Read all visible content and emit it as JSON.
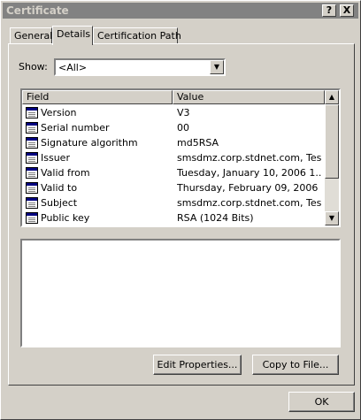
{
  "window": {
    "title": "Certificate"
  },
  "titlebar_buttons": {
    "help": "?",
    "close": "X"
  },
  "tabs": [
    {
      "label": "General"
    },
    {
      "label": "Details"
    },
    {
      "label": "Certification Path"
    }
  ],
  "show": {
    "label": "Show:",
    "value": "<All>"
  },
  "list": {
    "headers": {
      "field": "Field",
      "value": "Value"
    },
    "rows": [
      {
        "field": "Version",
        "value": "V3"
      },
      {
        "field": "Serial number",
        "value": "00"
      },
      {
        "field": "Signature algorithm",
        "value": "md5RSA"
      },
      {
        "field": "Issuer",
        "value": "smsdmz.corp.stdnet.com, Tes..."
      },
      {
        "field": "Valid from",
        "value": "Tuesday, January 10, 2006 1..."
      },
      {
        "field": "Valid to",
        "value": "Thursday, February 09, 2006 ..."
      },
      {
        "field": "Subject",
        "value": "smsdmz.corp.stdnet.com, Tes..."
      },
      {
        "field": "Public key",
        "value": "RSA (1024 Bits)"
      }
    ]
  },
  "buttons": {
    "edit_properties": "Edit Properties...",
    "copy_to_file": "Copy to File...",
    "ok": "OK"
  },
  "colors": {
    "face": "#d4d0c8",
    "titlebar_inactive": "#828282"
  },
  "icons": {
    "field_row": "certificate-field-icon"
  }
}
